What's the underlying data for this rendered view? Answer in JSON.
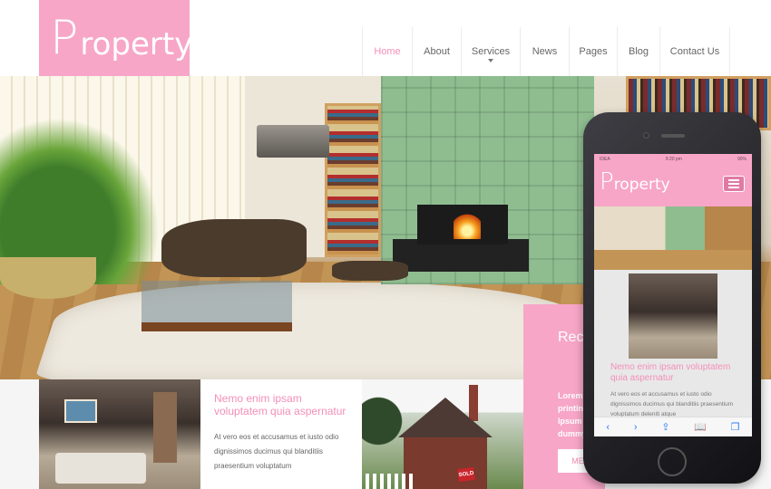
{
  "logo": {
    "first_letter": "P",
    "rest": "roperty"
  },
  "nav": {
    "items": [
      {
        "label": "Home",
        "active": true,
        "has_caret": false
      },
      {
        "label": "About",
        "active": false,
        "has_caret": false
      },
      {
        "label": "Services",
        "active": false,
        "has_caret": true
      },
      {
        "label": "News",
        "active": false,
        "has_caret": false
      },
      {
        "label": "Pages",
        "active": false,
        "has_caret": false
      },
      {
        "label": "Blog",
        "active": false,
        "has_caret": false
      },
      {
        "label": "Contact Us",
        "active": false,
        "has_caret": false
      }
    ]
  },
  "recent_panel": {
    "heading": "Rec",
    "lorem": "Lorem printing Ipsum dummy",
    "button": "ME"
  },
  "card": {
    "title": "Nemo enim ipsam voluptatem quia aspernatur",
    "body": "At vero eos et accusamus et iusto odio dignissimos ducimus qui blanditiis praesentium voluptatum"
  },
  "house_sign": "SOLD",
  "phone": {
    "status": {
      "carrier": "IDEA",
      "time": "9:20 pm",
      "battery": "90%"
    },
    "logo": {
      "first_letter": "P",
      "rest": "roperty"
    },
    "title": "Nemo enim ipsam voluptatem quia aspernatur",
    "body": "At vero eos et accusamus et iusto odio dignissimos ducimus qui blanditiis praesentium voluptatum deleniti atque",
    "toolbar_icons": [
      "back-arrow-icon",
      "forward-arrow-icon",
      "share-icon",
      "bookmarks-icon",
      "tabs-icon"
    ]
  },
  "colors": {
    "brand_pink": "#f7a6c8",
    "accent_text": "#f48fb8"
  }
}
